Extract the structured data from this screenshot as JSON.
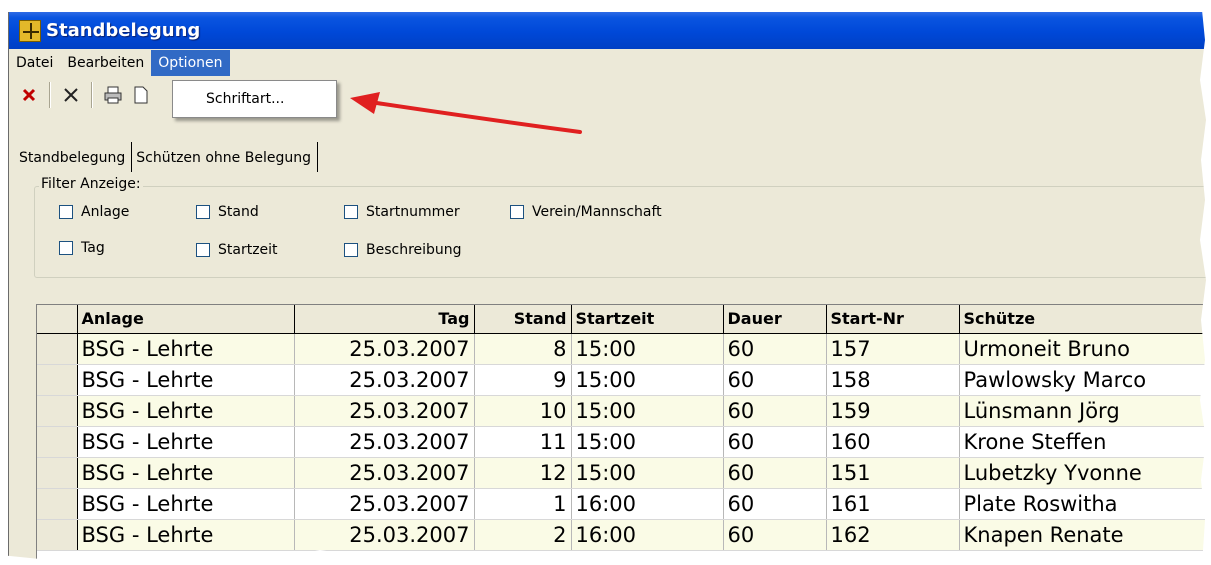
{
  "window": {
    "title": "Standbelegung",
    "icon": "app-icon"
  },
  "menubar": {
    "items": [
      "Datei",
      "Bearbeiten",
      "Optionen"
    ],
    "active": "Optionen"
  },
  "dropdown": {
    "items": [
      "Schriftart..."
    ]
  },
  "toolbar": {
    "buttons": [
      "delete-red-icon",
      "close-x-icon",
      "print-icon",
      "print-preview-icon"
    ]
  },
  "tabs": [
    "Standbelegung",
    "Schützen ohne Belegung"
  ],
  "filter": {
    "title": "Filter Anzeige:",
    "row1": [
      "Anlage",
      "Stand",
      "Startnummer",
      "Verein/Mannschaft"
    ],
    "row2": [
      "Tag",
      "Startzeit",
      "Beschreibung"
    ]
  },
  "table": {
    "columns": [
      "Anlage",
      "Tag",
      "Stand",
      "Startzeit",
      "Dauer",
      "Start-Nr",
      "Schütze"
    ],
    "rows": [
      [
        "BSG - Lehrte",
        "25.03.2007",
        "8",
        "15:00",
        "60",
        "157",
        "Urmoneit Bruno"
      ],
      [
        "BSG - Lehrte",
        "25.03.2007",
        "9",
        "15:00",
        "60",
        "158",
        "Pawlowsky Marco"
      ],
      [
        "BSG - Lehrte",
        "25.03.2007",
        "10",
        "15:00",
        "60",
        "159",
        "Lünsmann Jörg"
      ],
      [
        "BSG - Lehrte",
        "25.03.2007",
        "11",
        "15:00",
        "60",
        "160",
        "Krone Steffen"
      ],
      [
        "BSG - Lehrte",
        "25.03.2007",
        "12",
        "15:00",
        "60",
        "151",
        "Lubetzky Yvonne"
      ],
      [
        "BSG - Lehrte",
        "25.03.2007",
        "1",
        "16:00",
        "60",
        "161",
        "Plate Roswitha"
      ],
      [
        "BSG - Lehrte",
        "25.03.2007",
        "2",
        "16:00",
        "60",
        "162",
        "Knapen Renate"
      ]
    ]
  },
  "colors": {
    "title_bar": "#0048d8",
    "menu_highlight": "#316ac5",
    "arrow": "#e02020",
    "row_tint": "#fafbe6"
  }
}
